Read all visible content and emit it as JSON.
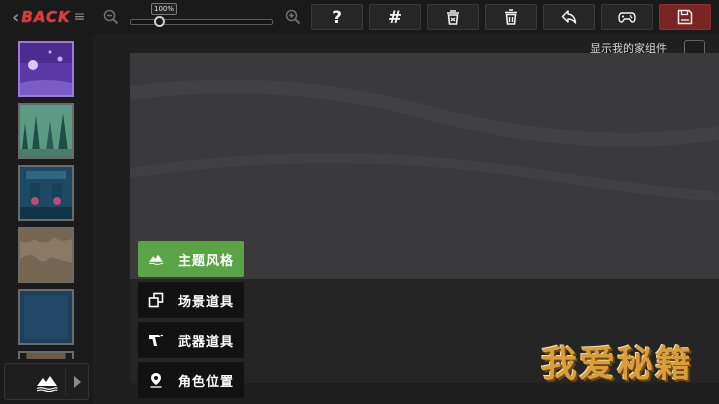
{
  "toolbar": {
    "back_label": "BACK",
    "zoom_level": "100%",
    "zoom_fraction": 0.2,
    "buttons": [
      {
        "icon": "help-icon"
      },
      {
        "icon": "grid-icon"
      },
      {
        "icon": "clear-all-icon"
      },
      {
        "icon": "delete-icon"
      },
      {
        "icon": "undo-icon"
      },
      {
        "icon": "gamepad-icon"
      },
      {
        "icon": "save-icon"
      }
    ],
    "save_color": "#7a2424"
  },
  "sidebar": {
    "thumbnails": [
      {
        "name": "theme-night-purple",
        "selected": true
      },
      {
        "name": "theme-forest",
        "selected": false
      },
      {
        "name": "theme-ocean",
        "selected": false
      },
      {
        "name": "theme-cave",
        "selected": false
      },
      {
        "name": "theme-deep-blue",
        "selected": false
      }
    ]
  },
  "canvas": {
    "show_home_components_label": "显示我的家组件",
    "show_home_components_checked": false
  },
  "menu": {
    "items": [
      {
        "label": "主题风格",
        "icon": "mountain-icon",
        "active": true
      },
      {
        "label": "场景道具",
        "icon": "props-icon",
        "active": false
      },
      {
        "label": "武器道具",
        "icon": "weapon-icon",
        "active": false
      },
      {
        "label": "角色位置",
        "icon": "location-pin-icon",
        "active": false
      }
    ],
    "active_color": "#5aa446"
  },
  "watermark": "我爱秘籍"
}
